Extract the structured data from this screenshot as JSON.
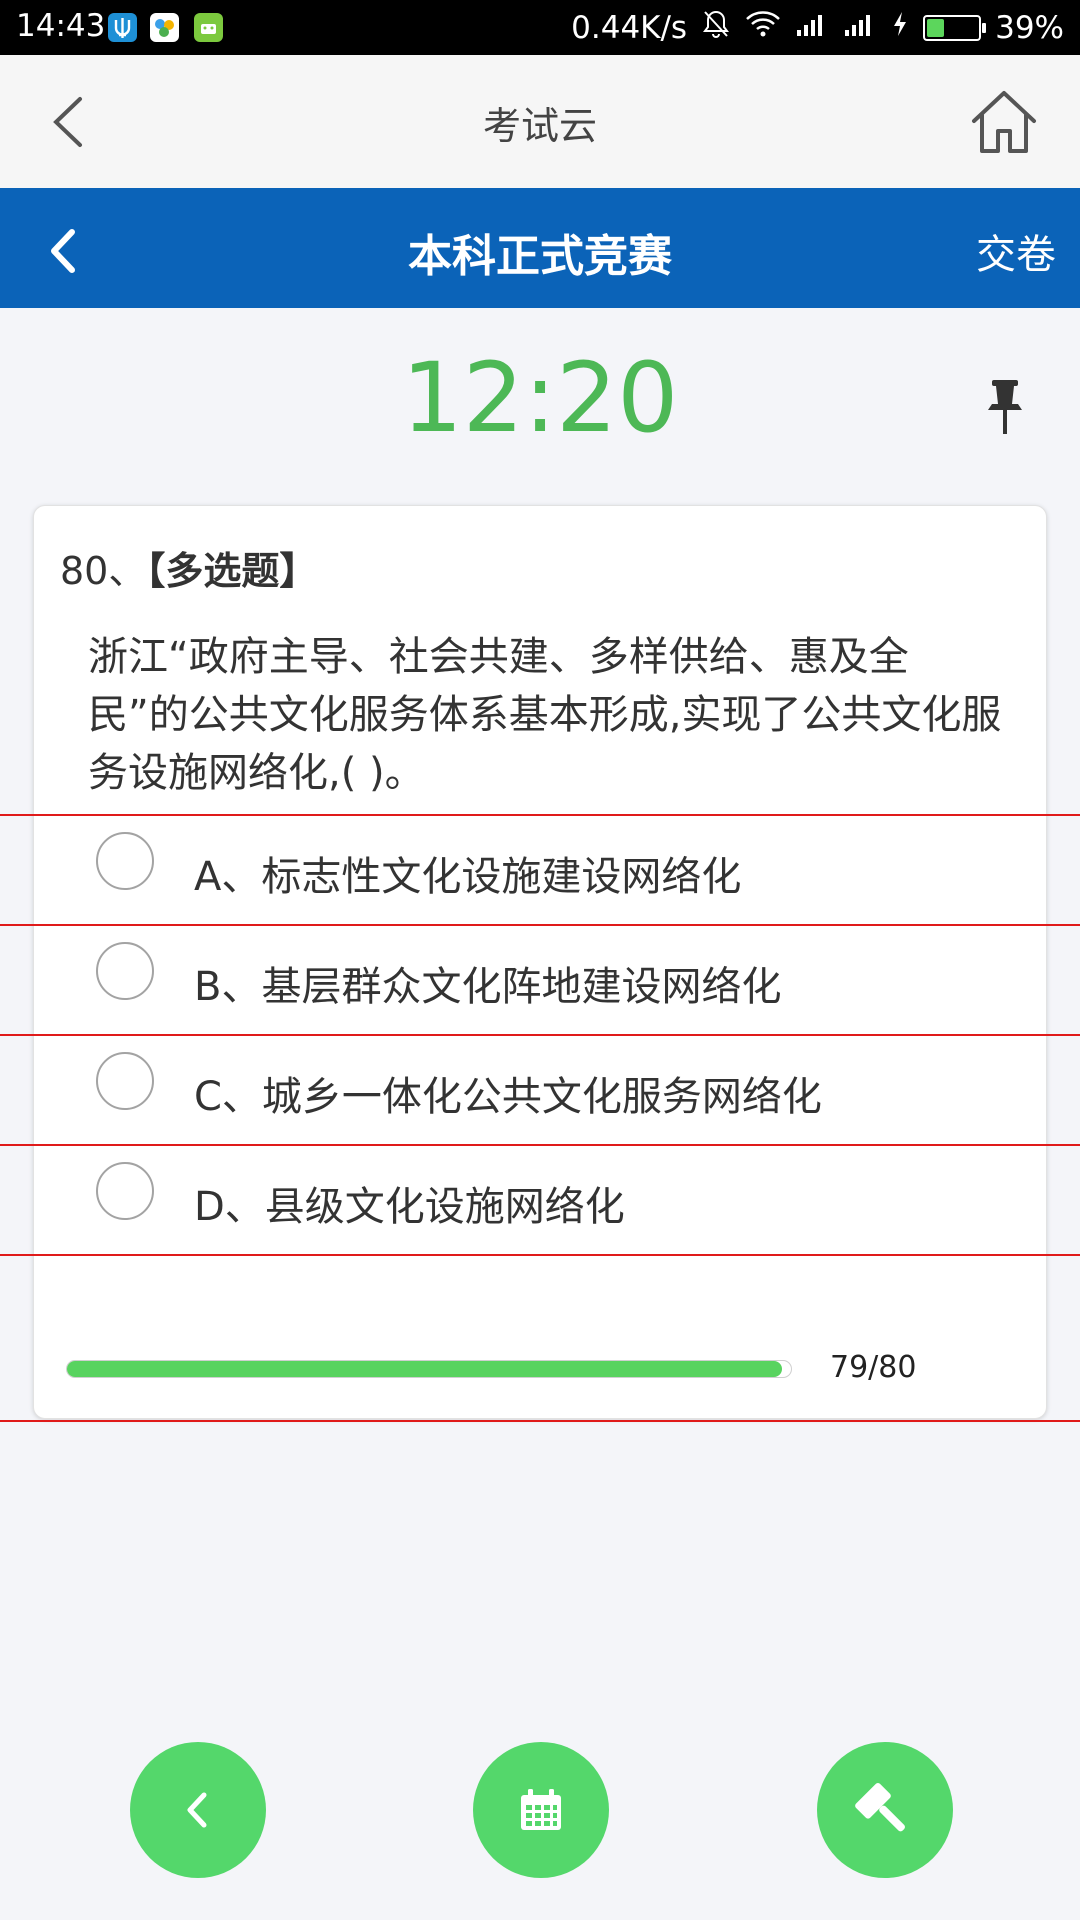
{
  "status_bar": {
    "time": "14:43",
    "network_speed": "0.44K/s",
    "battery_percent": "39%",
    "battery_level": 0.39,
    "notification_icons": [
      "trident-app-icon",
      "multicolor-app-icon",
      "green-android-icon"
    ]
  },
  "app_bar": {
    "title": "考试云"
  },
  "exam_bar": {
    "title": "本科正式竞赛",
    "submit_label": "交卷"
  },
  "timer": {
    "value": "12:20"
  },
  "question": {
    "number_prefix": "80、",
    "type": "【多选题】",
    "text": "浙江“政府主导、社会共建、多样供给、惠及全民”的公共文化服务体系基本形成,实现了公共文化服务设施网络化,( )。",
    "options": [
      {
        "label": "A、标志性文化设施建设网络化"
      },
      {
        "label": "B、基层群众文化阵地建设网络化"
      },
      {
        "label": "C、城乡一体化公共文化服务网络化"
      },
      {
        "label": "D、县级文化设施网络化"
      }
    ]
  },
  "progress": {
    "text": "79/80",
    "fraction": 0.9875
  },
  "bottom_actions": {
    "prev_icon": "chevron-left-icon",
    "calendar_icon": "calendar-icon",
    "hammer_icon": "gavel-icon"
  },
  "colors": {
    "exam_bar_bg": "#0b63b8",
    "timer": "#4db856",
    "fab": "#54d76b",
    "progress_fill": "#58d35f",
    "divider_red": "#e01a1a"
  }
}
